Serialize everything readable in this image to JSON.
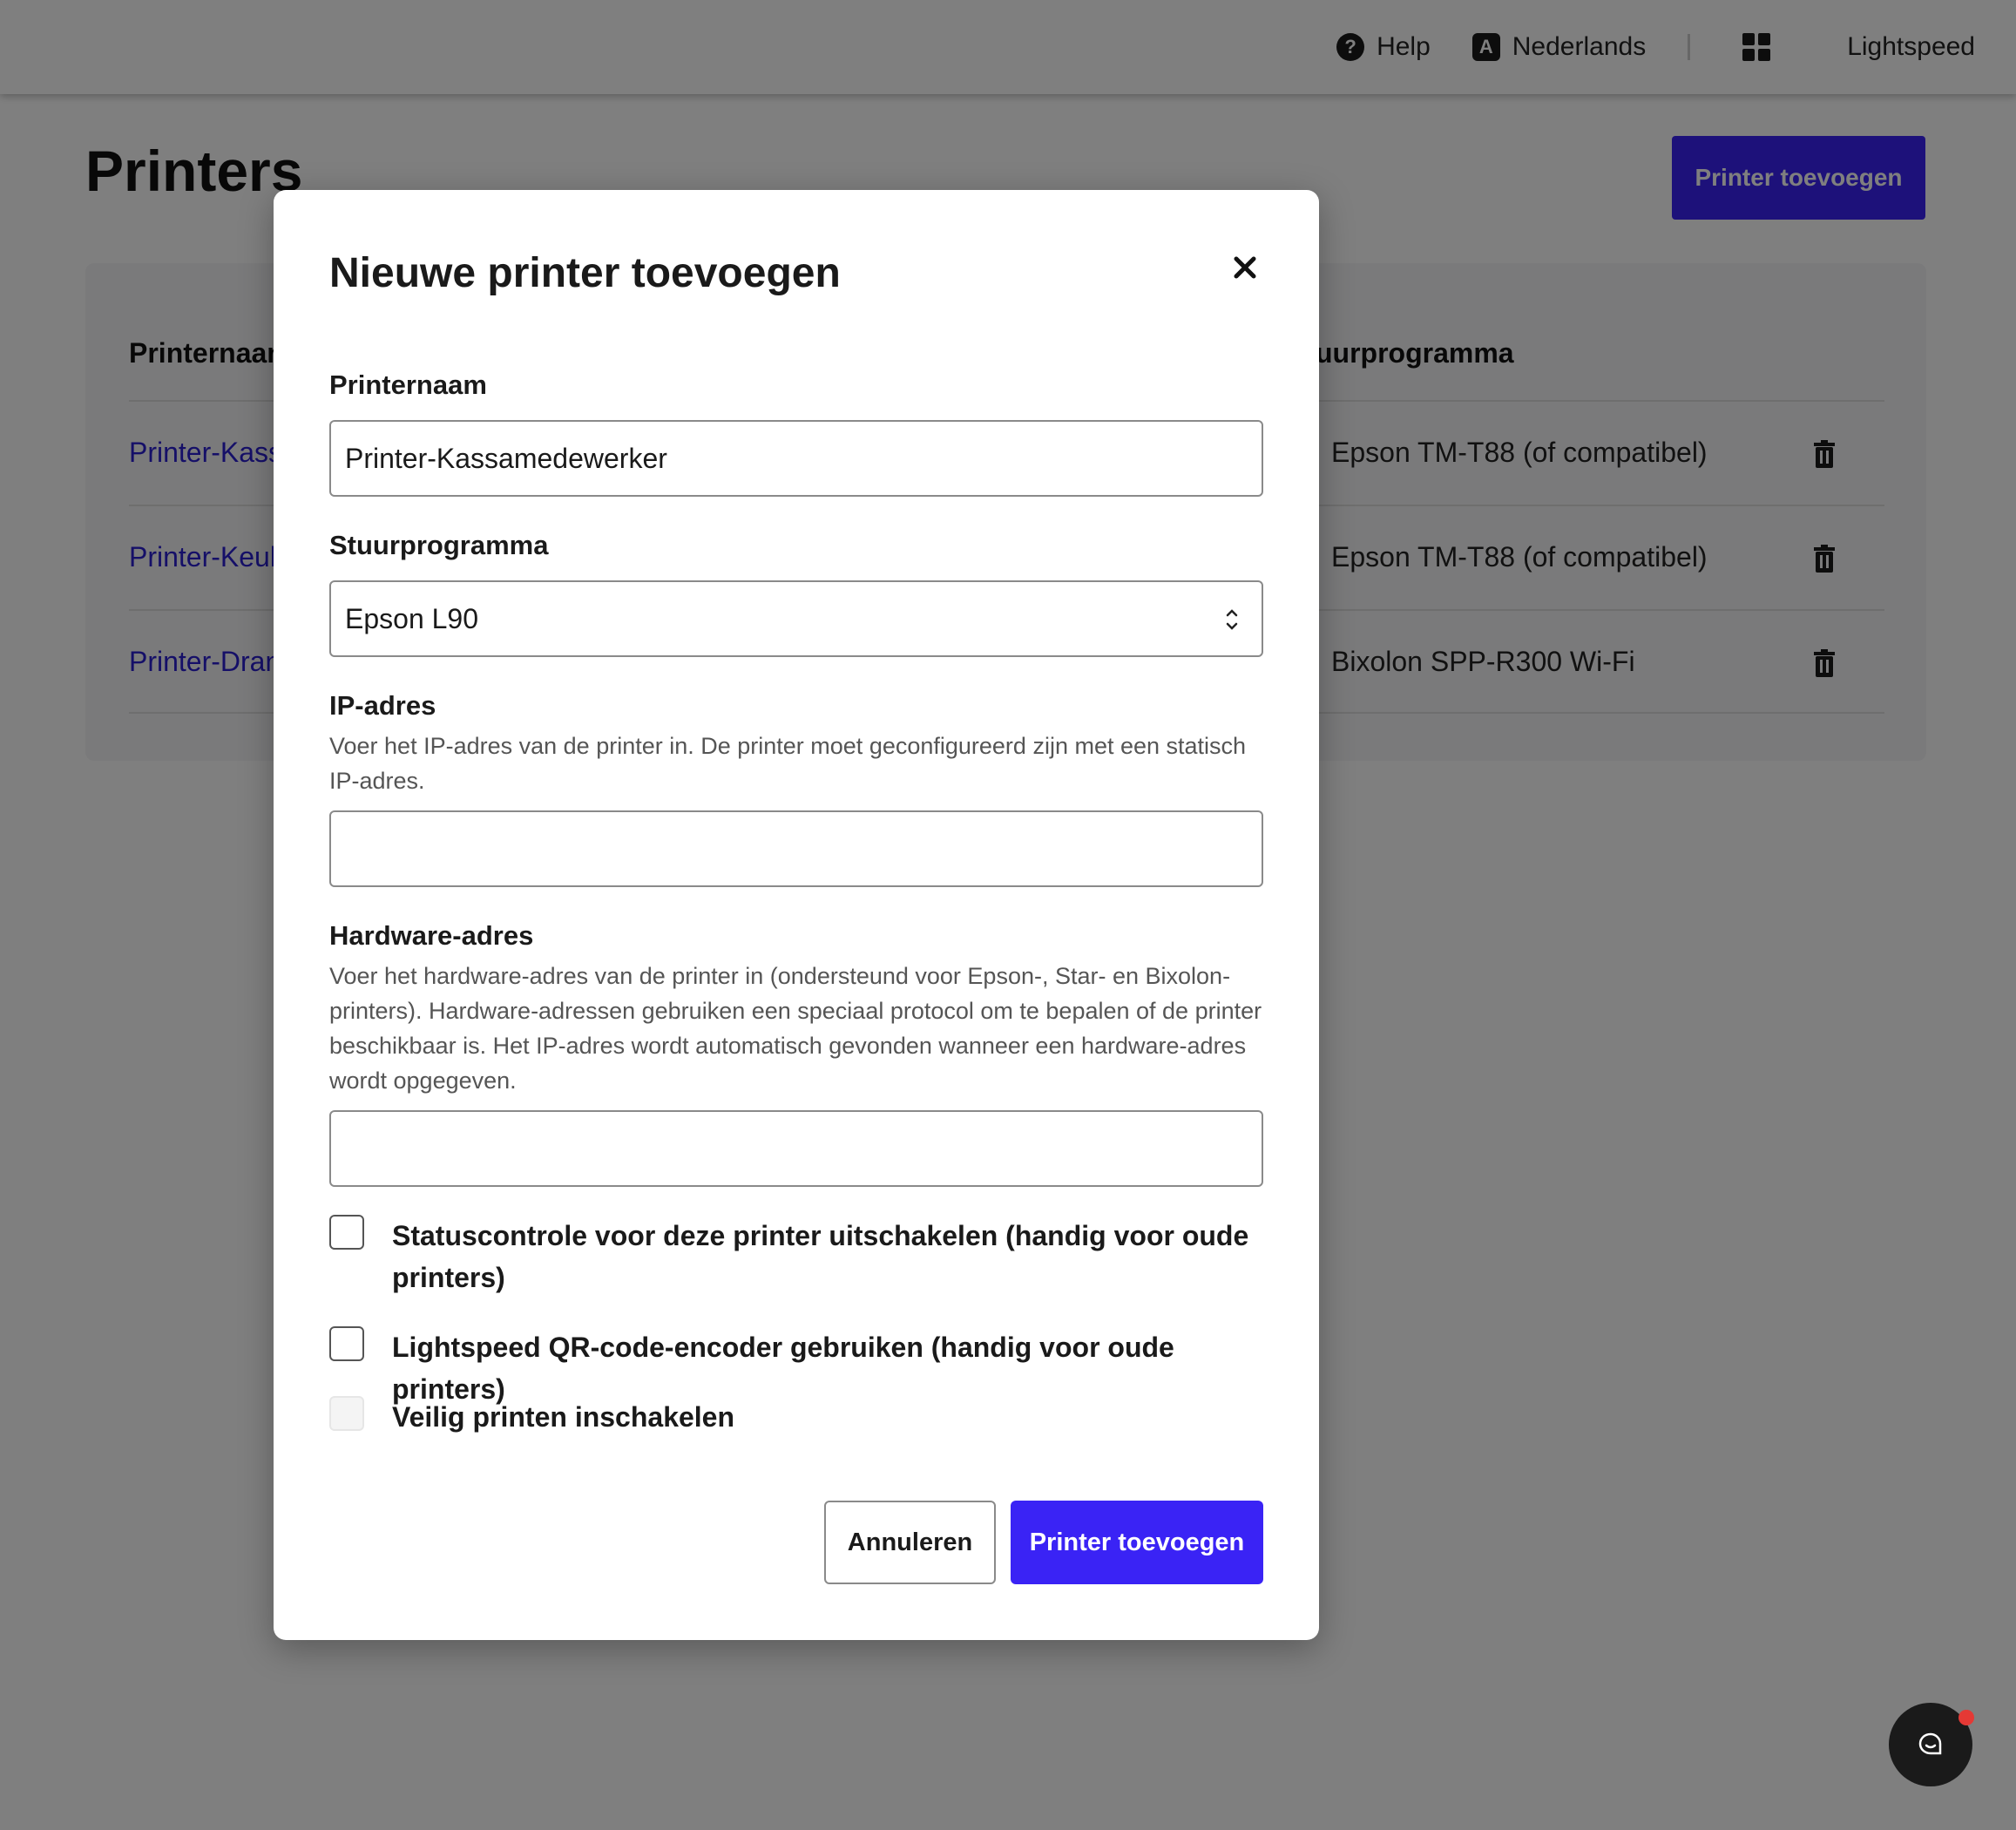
{
  "topbar": {
    "help_label": "Help",
    "help_icon_glyph": "?",
    "language_label": "Nederlands",
    "language_icon_glyph": "A",
    "app_name": "Lightspeed"
  },
  "page": {
    "title": "Printers",
    "add_button_label": "Printer toevoegen",
    "table": {
      "headers": {
        "name": "Printernaam",
        "driver": "Stuurprogramma"
      },
      "rows": [
        {
          "name": "Printer-Kassamedewerker",
          "driver": "Epson TM-T88 (of compatibel)"
        },
        {
          "name": "Printer-Keuken",
          "driver": "Epson TM-T88 (of compatibel)"
        },
        {
          "name": "Printer-Drank",
          "driver": "Bixolon SPP-R300 Wi-Fi"
        }
      ]
    }
  },
  "modal": {
    "title": "Nieuwe printer toevoegen",
    "printer_name": {
      "label": "Printernaam",
      "value": "Printer-Kassamedewerker"
    },
    "driver": {
      "label": "Stuurprogramma",
      "selected": "Epson L90"
    },
    "ip_address": {
      "label": "IP-adres",
      "help": "Voer het IP-adres van de printer in. De printer moet geconfigureerd zijn met een statisch IP-adres.",
      "value": ""
    },
    "hardware_address": {
      "label": "Hardware-adres",
      "help": "Voer het hardware-adres van de printer in (ondersteund voor Epson-, Star- en Bixolon-printers). Hardware-adressen gebruiken een speciaal protocol om te bepalen of de printer beschikbaar is. Het IP-adres wordt automatisch gevonden wanneer een hardware-adres wordt opgegeven.",
      "value": ""
    },
    "checkboxes": {
      "disable_status_check": {
        "label": "Statuscontrole voor deze printer uitschakelen (handig voor oude printers)",
        "checked": false
      },
      "qr_encoder": {
        "label": "Lightspeed QR-code-encoder gebruiken (handig voor oude printers)",
        "checked": false
      },
      "secure_printing": {
        "label": "Veilig printen inschakelen",
        "checked": false,
        "disabled": true
      }
    },
    "cancel_label": "Annuleren",
    "submit_label": "Printer toevoegen"
  },
  "icons": {
    "help": "help-circle-icon",
    "language": "language-icon",
    "apps": "apps-grid-icon",
    "delete": "trash-icon",
    "close": "close-icon",
    "select": "chevron-up-down-icon",
    "chat": "chat-icon"
  },
  "colors": {
    "accent": "#3a23f5",
    "link": "#2b1fd0",
    "notification": "#e53935"
  }
}
